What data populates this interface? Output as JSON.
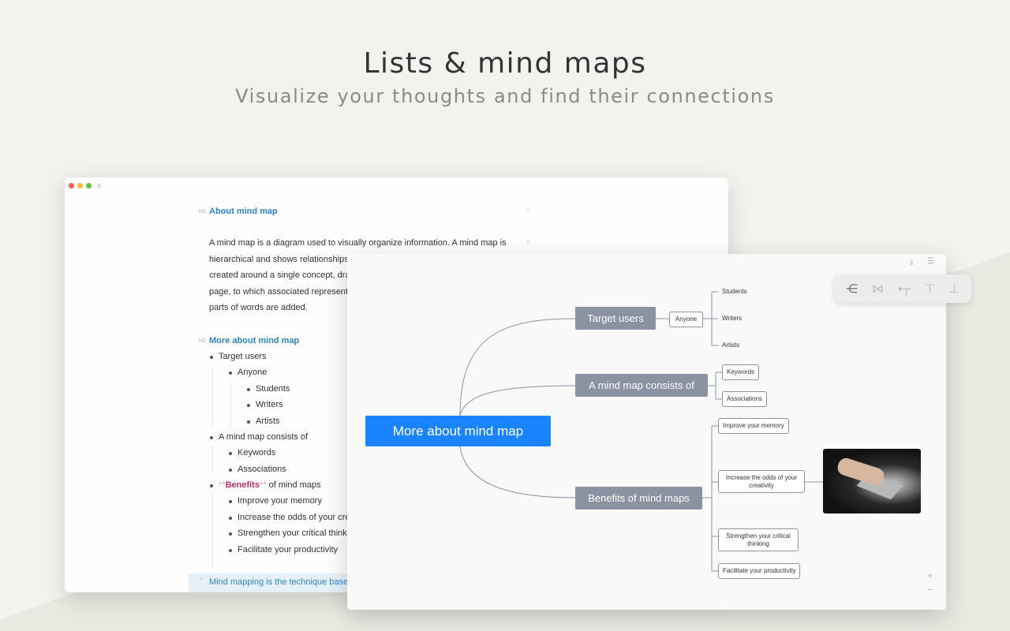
{
  "hero": {
    "title": "Lists & mind maps",
    "subtitle": "Visualize your thoughts and find their connections"
  },
  "editor": {
    "h1_label": "H1",
    "h1": "About mind map",
    "line1": "1",
    "line2": "2",
    "paragraph": [
      "A mind map is a diagram used to visually organize information. A mind map is",
      "hierarchical and shows relationships a",
      "created around a single concept, draw",
      "page, to which associated representa",
      "parts of words are added."
    ],
    "h2_label": "H2",
    "h2": "More about mind map",
    "list": {
      "target_users": "Target users",
      "anyone": "Anyone",
      "students": "Students",
      "writers": "Writers",
      "artists": "Artists",
      "consists": "A mind map consists of",
      "keywords": "Keywords",
      "associations": "Associations",
      "benefits_marks": "**",
      "benefits": "Benefits",
      "benefits_rest": " of mind maps",
      "memory": "Improve your memory",
      "odds": "Increase the odds of your crea",
      "critical": "Strengthen your critical thinki",
      "productivity": "Facilitate your productivity"
    },
    "quote_mark": "“",
    "quote": "Mind mapping is the technique based"
  },
  "mindmap": {
    "center": "More about mind map",
    "target_users": "Target users",
    "anyone": "Anyone",
    "students": "Students",
    "writers": "Writers",
    "artists": "Artists",
    "consists": "A mind map consists of",
    "keywords": "Keywords",
    "associations": "Associations",
    "benefits": "Benefits of mind maps",
    "memory": "Improve your memory",
    "odds": "Increase the odds of your creativity",
    "critical": "Strengthen your critical thinking",
    "productivity": "Facilitate your productivity",
    "zoom_in": "+",
    "zoom_out": "−"
  },
  "colors": {
    "accent": "#1a84ff",
    "branch": "#8b93a2",
    "heading": "#2f86c8",
    "highlight": "#c0306e"
  }
}
